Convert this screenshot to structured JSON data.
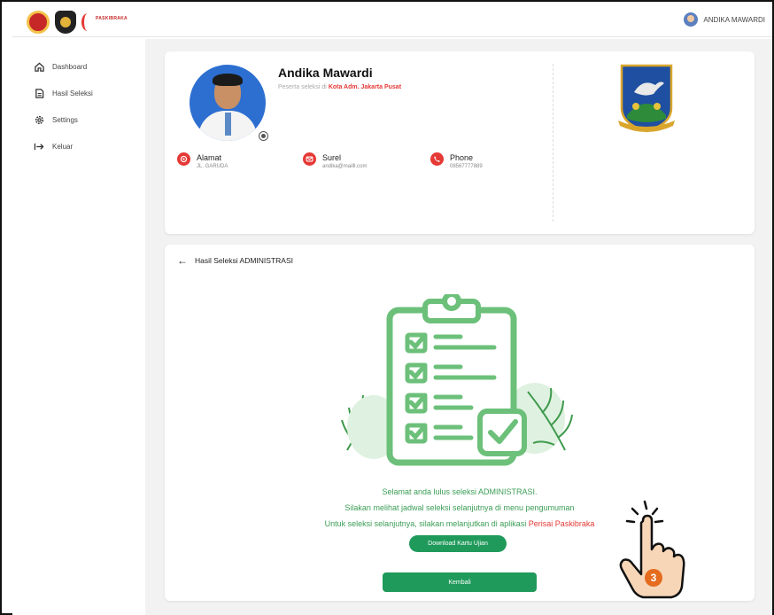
{
  "header": {
    "logo_text": "PASKIBRAKA",
    "user_name": "ANDIKA MAWARDI"
  },
  "sidebar": {
    "items": [
      {
        "label": "Dashboard",
        "icon": "home-icon"
      },
      {
        "label": "Hasil Seleksi",
        "icon": "document-icon"
      },
      {
        "label": "Settings",
        "icon": "gear-icon"
      },
      {
        "label": "Keluar",
        "icon": "logout-icon"
      }
    ]
  },
  "profile": {
    "name": "Andika Mawardi",
    "subtitle_prefix": "Peserta seleksi di",
    "city": "Kota Adm. Jakarta Pusat",
    "address_label": "Alamat",
    "address_value": "JL. GARUDA",
    "email_label": "Surel",
    "email_value": "andika@mailll.com",
    "phone_label": "Phone",
    "phone_value": "08567777889"
  },
  "result": {
    "back_title": "Hasil Seleksi ADMINISTRASI",
    "message_line1": "Selamat anda lulus seleksi ADMINISTRASI.",
    "message_line2": "Silakan melihat jadwal seleksi selanjutnya di menu pengumuman",
    "message_line3_prefix": "Untuk seleksi selanjutnya, silakan melanjutkan di aplikasi",
    "message_line3_link": "Perisai Paskibraka",
    "download_button": "Download Kartu Ujian",
    "back_button": "Kembali"
  },
  "cursor": {
    "step_badge": "3"
  },
  "colors": {
    "brand_green": "#1f9a5b",
    "accent_red": "#e53935",
    "illustration_green": "#6cc07a"
  }
}
